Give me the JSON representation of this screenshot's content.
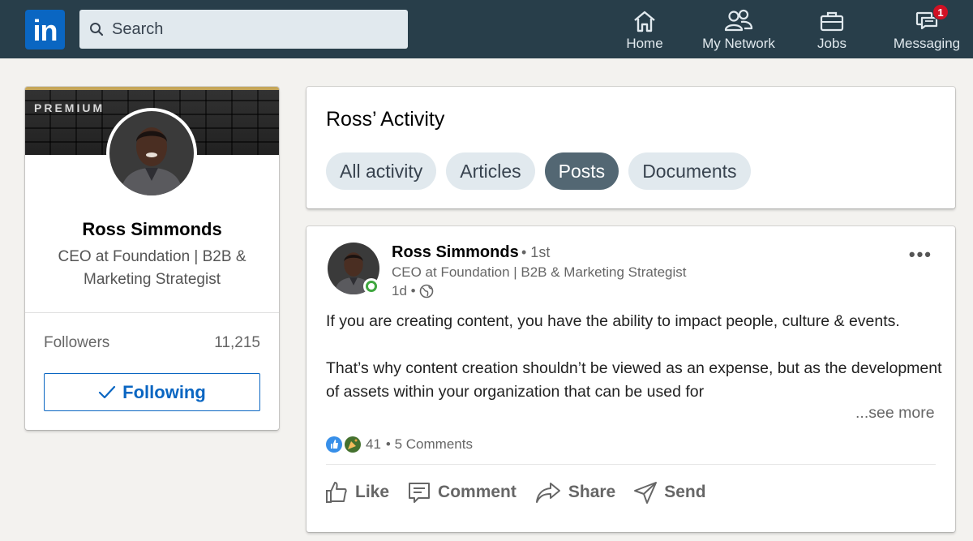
{
  "nav": {
    "logo_text": "in",
    "search": {
      "placeholder": "Search"
    },
    "items": [
      {
        "label": "Home",
        "icon": "home-icon"
      },
      {
        "label": "My Network",
        "icon": "network-icon"
      },
      {
        "label": "Jobs",
        "icon": "briefcase-icon"
      },
      {
        "label": "Messaging",
        "icon": "messaging-icon",
        "badge": "1"
      }
    ]
  },
  "profile": {
    "premium_label": "PREMIUM",
    "name": "Ross Simmonds",
    "headline": "CEO at Foundation | B2B & Marketing Strategist",
    "followers_label": "Followers",
    "followers_count": "11,215",
    "follow_button": "Following"
  },
  "activity": {
    "title": "Ross’ Activity",
    "tabs": [
      {
        "label": "All activity",
        "active": false
      },
      {
        "label": "Articles",
        "active": false
      },
      {
        "label": "Posts",
        "active": true
      },
      {
        "label": "Documents",
        "active": false
      }
    ]
  },
  "post": {
    "author": "Ross Simmonds",
    "degree": "• 1st",
    "headline": "CEO at Foundation | B2B & Marketing Strategist",
    "time": "1d •",
    "paragraph1": "If you are creating content, you have the ability to impact people, culture & events.",
    "paragraph2": "That’s why content creation shouldn’t be viewed as an expense, but as the development of assets within your organization that can be used for",
    "see_more": "...see more",
    "reaction_count": "41",
    "comments": "• 5 Comments",
    "actions": {
      "like": "Like",
      "comment": "Comment",
      "share": "Share",
      "send": "Send"
    }
  },
  "colors": {
    "nav_bg": "#283e4a",
    "brand_blue": "#0a66c2",
    "active_pill": "#536773",
    "pill": "#e1e9ee",
    "online": "#3fa63f",
    "badge": "#d11124"
  }
}
